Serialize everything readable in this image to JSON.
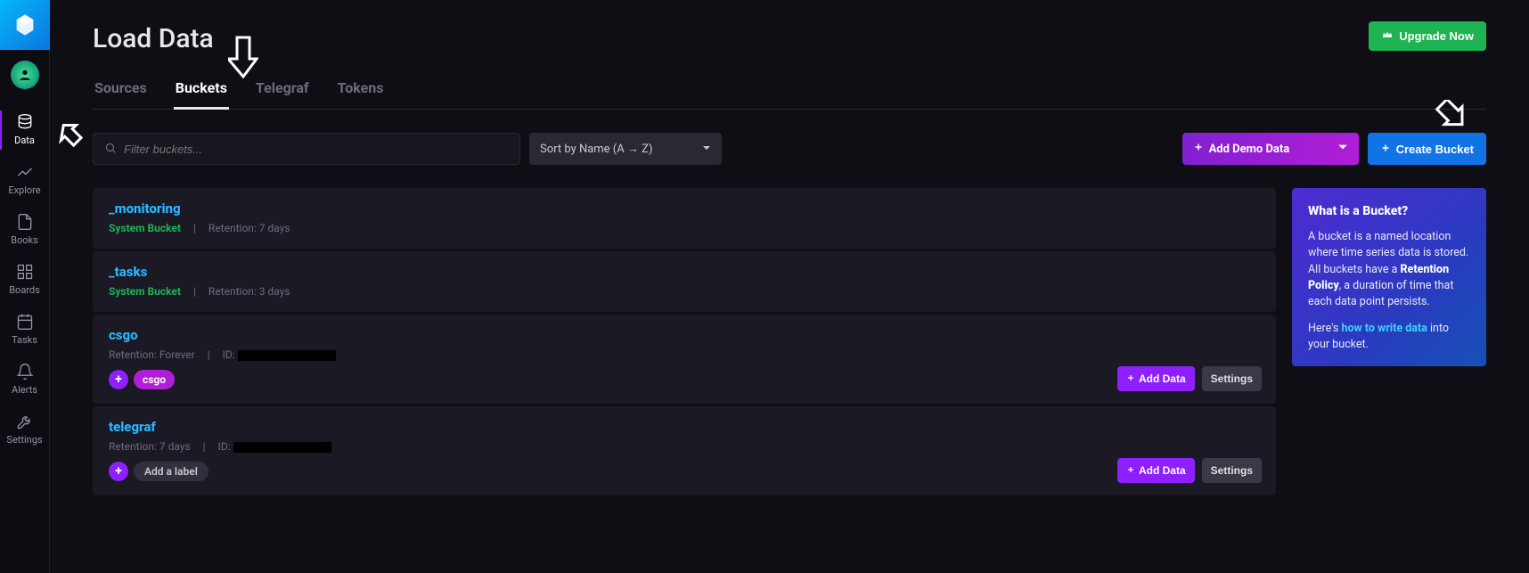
{
  "sidebar": {
    "items": [
      {
        "label": "Data"
      },
      {
        "label": "Explore"
      },
      {
        "label": "Books"
      },
      {
        "label": "Boards"
      },
      {
        "label": "Tasks"
      },
      {
        "label": "Alerts"
      },
      {
        "label": "Settings"
      }
    ]
  },
  "header": {
    "title": "Load Data",
    "upgrade_label": "Upgrade Now"
  },
  "tabs": [
    {
      "label": "Sources"
    },
    {
      "label": "Buckets"
    },
    {
      "label": "Telegraf"
    },
    {
      "label": "Tokens"
    }
  ],
  "toolbar": {
    "filter_placeholder": "Filter buckets...",
    "sort_label": "Sort by Name (A → Z)",
    "demo_label": "Add Demo Data",
    "create_label": "Create Bucket"
  },
  "buckets": [
    {
      "name": "_monitoring",
      "system_label": "System Bucket",
      "retention": "Retention: 7 days",
      "has_actions": false
    },
    {
      "name": "_tasks",
      "system_label": "System Bucket",
      "retention": "Retention: 3 days",
      "has_actions": false
    },
    {
      "name": "csgo",
      "retention": "Retention: Forever",
      "id_label": "ID:",
      "tags": [
        "csgo"
      ],
      "has_actions": true
    },
    {
      "name": "telegraf",
      "retention": "Retention: 7 days",
      "id_label": "ID:",
      "add_label": "Add a label",
      "has_actions": true
    }
  ],
  "actions": {
    "add_data": "Add Data",
    "settings": "Settings"
  },
  "info": {
    "title": "What is a Bucket?",
    "p1a": "A bucket is a named location where time series data is stored. All buckets have a ",
    "p1b": "Retention Policy",
    "p1c": ", a duration of time that each data point persists.",
    "p2a": "Here's ",
    "p2b": "how to write data",
    "p2c": " into your bucket."
  }
}
